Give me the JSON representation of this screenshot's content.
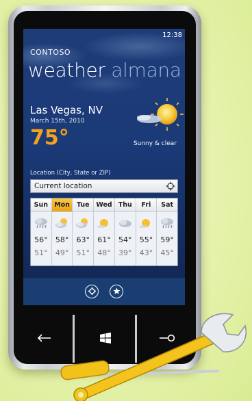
{
  "status": {
    "time": "12:38"
  },
  "app": {
    "brand": "CONTOSO",
    "title_word1": "weather",
    "title_word2": "almana"
  },
  "current": {
    "city": "Las Vegas, NV",
    "date": "March 15th, 2010",
    "temperature": "75°",
    "condition": "Sunny & clear",
    "icon": "sun-with-cloud-icon"
  },
  "location": {
    "label": "Location (City, State or ZIP)",
    "value": "Current location",
    "icon": "target-icon"
  },
  "forecast": [
    {
      "day": "Sun",
      "hi": "56°",
      "lo": "51°",
      "icon": "cloud-rain"
    },
    {
      "day": "Mon",
      "hi": "58°",
      "lo": "49°",
      "icon": "partly-cloudy",
      "selected": true
    },
    {
      "day": "Tue",
      "hi": "63°",
      "lo": "51°",
      "icon": "partly-cloudy"
    },
    {
      "day": "Wed",
      "hi": "61°",
      "lo": "48°",
      "icon": "sunny"
    },
    {
      "day": "Thu",
      "hi": "54°",
      "lo": "39°",
      "icon": "cloudy"
    },
    {
      "day": "Fri",
      "hi": "55°",
      "lo": "43°",
      "icon": "sunny"
    },
    {
      "day": "Sat",
      "hi": "59°",
      "lo": "45°",
      "icon": "cloud-rain"
    }
  ],
  "appbar": {
    "buttons": [
      "settings-icon",
      "favorite-icon"
    ]
  },
  "hardware": {
    "buttons": [
      "back-arrow-icon",
      "windows-start-icon",
      "search-icon"
    ]
  },
  "colors": {
    "accent": "#f4a21a",
    "screen_bg": "#1b3a78",
    "selected_day": "#f0b02a"
  }
}
